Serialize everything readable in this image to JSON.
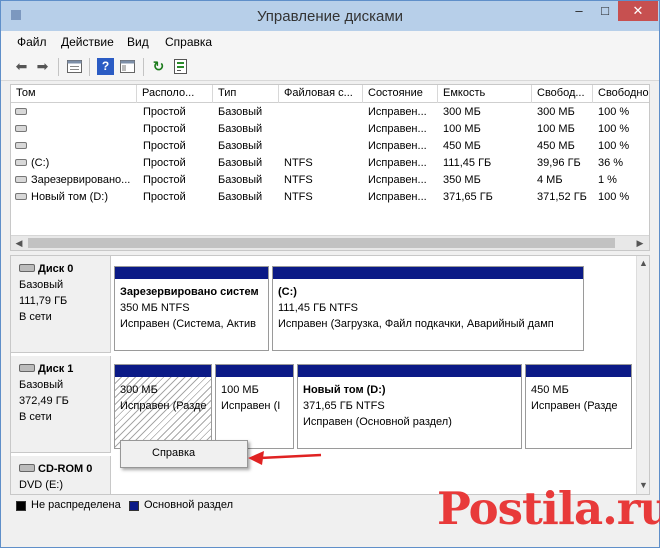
{
  "window": {
    "title": "Управление дисками",
    "controls": {
      "minimize": "–",
      "maximize": "□",
      "close": "✕"
    }
  },
  "menu": [
    "Файл",
    "Действие",
    "Вид",
    "Справка"
  ],
  "toolbar": {
    "icons": [
      "back-arrow-icon",
      "forward-arrow-icon",
      "properties-icon",
      "help-icon",
      "panel-icon",
      "refresh-icon",
      "rescan-icon"
    ],
    "glyphs": {
      "back": "⬅",
      "forward": "➡",
      "help": "?",
      "refresh": "↻"
    }
  },
  "volumes": {
    "columns": [
      "Том",
      "Располо...",
      "Тип",
      "Файловая с...",
      "Состояние",
      "Емкость",
      "Свобод...",
      "Свободно"
    ],
    "rows": [
      [
        "",
        "Простой",
        "Базовый",
        "",
        "Исправен...",
        "300 МБ",
        "300 МБ",
        "100 %"
      ],
      [
        "",
        "Простой",
        "Базовый",
        "",
        "Исправен...",
        "100 МБ",
        "100 МБ",
        "100 %"
      ],
      [
        "",
        "Простой",
        "Базовый",
        "",
        "Исправен...",
        "450 МБ",
        "450 МБ",
        "100 %"
      ],
      [
        "(C:)",
        "Простой",
        "Базовый",
        "NTFS",
        "Исправен...",
        "111,45 ГБ",
        "39,96 ГБ",
        "36 %"
      ],
      [
        "Зарезервировано...",
        "Простой",
        "Базовый",
        "NTFS",
        "Исправен...",
        "350 МБ",
        "4 МБ",
        "1 %"
      ],
      [
        "Новый том (D:)",
        "Простой",
        "Базовый",
        "NTFS",
        "Исправен...",
        "371,65 ГБ",
        "371,52 ГБ",
        "100 %"
      ]
    ]
  },
  "disks": [
    {
      "name": "Диск 0",
      "type": "Базовый",
      "size": "111,79 ГБ",
      "status": "В сети",
      "partitions": [
        {
          "name": "Зарезервировано систем",
          "size": "350 МБ NTFS",
          "status": "Исправен (Система, Актив"
        },
        {
          "name": "(C:)",
          "size": "111,45 ГБ NTFS",
          "status": "Исправен (Загрузка, Файл подкачки, Аварийный дамп"
        }
      ]
    },
    {
      "name": "Диск 1",
      "type": "Базовый",
      "size": "372,49 ГБ",
      "status": "В сети",
      "partitions": [
        {
          "name": "",
          "size": "300 МБ",
          "status": "Исправен (Разде"
        },
        {
          "name": "",
          "size": "100 МБ",
          "status": "Исправен (I"
        },
        {
          "name": "Новый том  (D:)",
          "size": "371,65 ГБ NTFS",
          "status": "Исправен (Основной раздел)"
        },
        {
          "name": "",
          "size": "450 МБ",
          "status": "Исправен (Разде"
        }
      ]
    },
    {
      "name": "CD-ROM 0",
      "type": "DVD (E:)"
    }
  ],
  "legend": [
    {
      "label": "Не распределена",
      "color": "#000000"
    },
    {
      "label": "Основной раздел",
      "color": "#0b1a86"
    }
  ],
  "context_menu": {
    "items": [
      "Справка"
    ]
  },
  "annotation": {
    "arrow_color": "#e02222"
  },
  "watermark": "Postila.ru",
  "colors": {
    "partition_bar": "#0b1a86",
    "titlebar": "#b7cfe9",
    "close_button": "#c75050"
  }
}
